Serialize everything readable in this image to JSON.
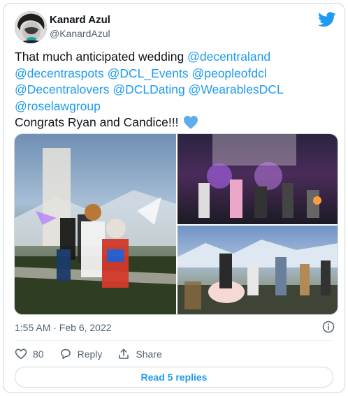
{
  "author": {
    "name": "Kanard Azul",
    "handle": "@KanardAzul"
  },
  "tweet": {
    "line1_text": "That much anticipated wedding ",
    "m1": "@decentraland",
    "m2": "@decentraspots",
    "m3": "@DCL_Events",
    "m4": "@peopleofdcl",
    "m5": "@Decentralovers",
    "m6": "@DCLDating",
    "m7": "@WearablesDCL",
    "m8": "@roselawgroup",
    "congrats": "Congrats Ryan and Candice!!!"
  },
  "meta": {
    "timestamp": "1:55 AM · Feb 6, 2022"
  },
  "actions": {
    "likes": "80",
    "reply": "Reply",
    "share": "Share"
  },
  "replies_button": "Read 5 replies",
  "colors": {
    "accent": "#1d9bf0",
    "text": "#0f1419",
    "muted": "#536471"
  }
}
